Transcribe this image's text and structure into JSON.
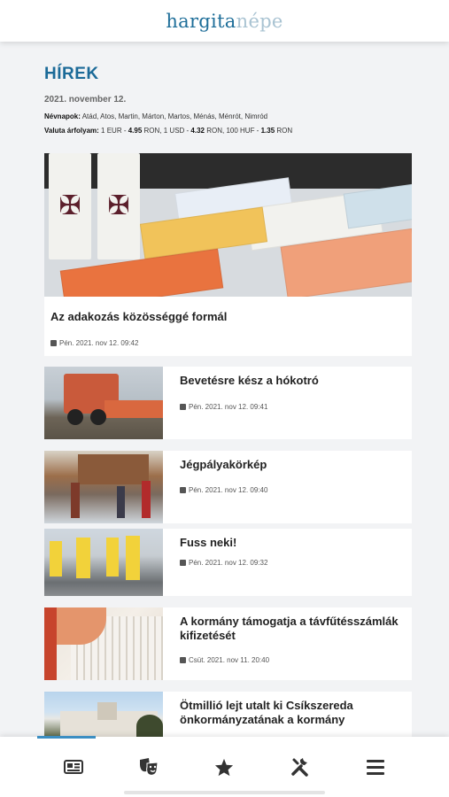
{
  "header": {
    "logo_part1": "hargita",
    "logo_part2": "népe"
  },
  "section": {
    "title": "HÍREK",
    "date": "2021. november 12.",
    "nevnapok_label": "Névnapok:",
    "nevnapok_value": " Atád, Atos, Martin, Márton, Martos, Ménás, Ménrót, Nimród",
    "valuta_label": "Valuta árfolyam:",
    "valuta_p1": " 1 EUR - ",
    "valuta_v1": "4.95",
    "valuta_p2": " RON, 1 USD - ",
    "valuta_v2": "4.32",
    "valuta_p3": " RON, 100 HUF - ",
    "valuta_v3": "1.35",
    "valuta_p4": " RON"
  },
  "featured": {
    "title": "Az adakozás közösséggé formál",
    "date": "Pén. 2021. nov 12. 09:42",
    "image_icon": "caritas-cross-icon"
  },
  "articles": [
    {
      "title": "Bevetésre kész a hókotró",
      "date": "Pén. 2021. nov 12. 09:41"
    },
    {
      "title": "Jégpályakörkép",
      "date": "Pén. 2021. nov 12. 09:40"
    },
    {
      "title": "Fuss neki!",
      "date": "Pén. 2021. nov 12. 09:32"
    },
    {
      "title": "A kormány támogatja a távfűtésszámlák kifizetését",
      "date": "Csüt. 2021. nov 11. 20:40"
    },
    {
      "title": "Ötmillió lejt utalt ki Csíkszereda önkormányzatának a kormány",
      "date": ""
    }
  ],
  "bottom_nav": {
    "items": [
      {
        "icon": "newspaper-icon"
      },
      {
        "icon": "theater-masks-icon"
      },
      {
        "icon": "star-icon"
      },
      {
        "icon": "tools-icon"
      },
      {
        "icon": "menu-icon"
      }
    ]
  },
  "colors": {
    "accent": "#1b6a98",
    "background": "#f2f3f5",
    "card": "#ffffff"
  }
}
